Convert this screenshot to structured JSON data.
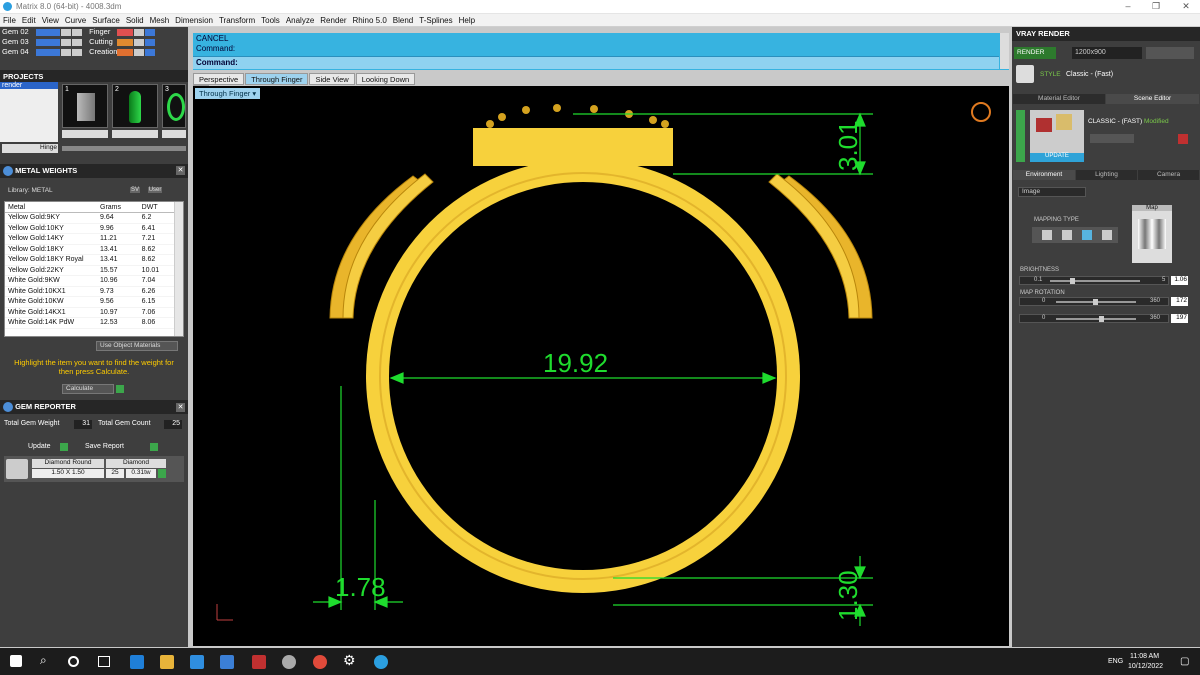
{
  "window": {
    "title": "Matrix 8.0 (64-bit) - 4008.3dm"
  },
  "menu": [
    "File",
    "Edit",
    "View",
    "Curve",
    "Surface",
    "Solid",
    "Mesh",
    "Dimension",
    "Transform",
    "Tools",
    "Analyze",
    "Render",
    "Rhino 5.0",
    "Blend",
    "T-Splines",
    "Help"
  ],
  "layers_left": [
    "Gem 02",
    "Gem 03",
    "Gem 04"
  ],
  "layers_right": [
    "Finger",
    "Cutting",
    "Creation"
  ],
  "projects": {
    "header": "PROJECTS",
    "selected": "render",
    "thumbs": [
      "1",
      "2",
      "3"
    ],
    "hinge_label": "Hinge"
  },
  "metal_weights": {
    "header": "METAL WEIGHTS",
    "library_label": "Library: METAL",
    "tag_sv": "SV",
    "tag_user": "User",
    "columns": [
      "Metal",
      "Grams",
      "DWT"
    ],
    "rows": [
      [
        "Yellow Gold:9KY",
        "9.64",
        "6.2"
      ],
      [
        "Yellow Gold:10KY",
        "9.96",
        "6.41"
      ],
      [
        "Yellow Gold:14KY",
        "11.21",
        "7.21"
      ],
      [
        "Yellow Gold:18KY",
        "13.41",
        "8.62"
      ],
      [
        "Yellow Gold:18KY Royal",
        "13.41",
        "8.62"
      ],
      [
        "Yellow Gold:22KY",
        "15.57",
        "10.01"
      ],
      [
        "White Gold:9KW",
        "10.96",
        "7.04"
      ],
      [
        "White Gold:10KX1",
        "9.73",
        "6.26"
      ],
      [
        "White Gold:10KW",
        "9.56",
        "6.15"
      ],
      [
        "White Gold:14KX1",
        "10.97",
        "7.06"
      ],
      [
        "White Gold:14K PdW",
        "12.53",
        "8.06"
      ]
    ],
    "use_object_materials": "Use Object Materials",
    "hint": "Highlight the item you want to find the weight for then press Calculate.",
    "calculate": "Calculate"
  },
  "gem_reporter": {
    "header": "GEM REPORTER",
    "total_weight_label": "Total Gem Weight",
    "total_weight": "31",
    "total_count_label": "Total Gem Count",
    "total_count": "25",
    "update": "Update",
    "save_report": "Save Report",
    "gem_name": "Diamond Round",
    "gem_size": "1.50 X 1.50",
    "material": "Diamond",
    "count": "25",
    "ctw": "0.31tw"
  },
  "command": {
    "line1": "CANCEL",
    "line2": "Command:",
    "prompt": "Command:"
  },
  "tabs": [
    "Perspective",
    "Through Finger",
    "Side View",
    "Looking Down"
  ],
  "active_tab": "Through Finger",
  "viewport_label": "Through Finger",
  "dimensions": {
    "inner_diameter": "19.92",
    "top_height": "3.01",
    "bottom_thickness": "1.30",
    "side_width": "1.78"
  },
  "vray": {
    "header": "VRAY RENDER",
    "render_btn": "RENDER",
    "resolution": "1200x900",
    "style_label": "STYLE",
    "style_value": "Classic - (Fast)",
    "tab_material": "Material Editor",
    "tab_scene": "Scene Editor",
    "preset_name": "CLASSIC - (FAST)",
    "preset_status": "Modified",
    "update": "UPDATE",
    "env_tabs": [
      "Environment",
      "Lighting",
      "Camera"
    ],
    "env_type": "Image",
    "mapping_type": "MAPPING TYPE",
    "map_label": "Map",
    "brightness_label": "BRIGHTNESS",
    "brightness_min": "0.1",
    "brightness_max": "5",
    "brightness_value": "1.06",
    "map_rotation_label": "MAP ROTATION",
    "rot1_min": "0",
    "rot1_max": "360",
    "rot1_value": "172",
    "rot2_min": "0",
    "rot2_max": "360",
    "rot2_value": "197"
  },
  "taskbar": {
    "lang": "ENG",
    "time": "11:08 AM",
    "date": "10/12/2022"
  },
  "colors": {
    "accent_blue": "#37b3e0",
    "gold": "#f7d13c",
    "dimension_green": "#1fdc2e"
  }
}
